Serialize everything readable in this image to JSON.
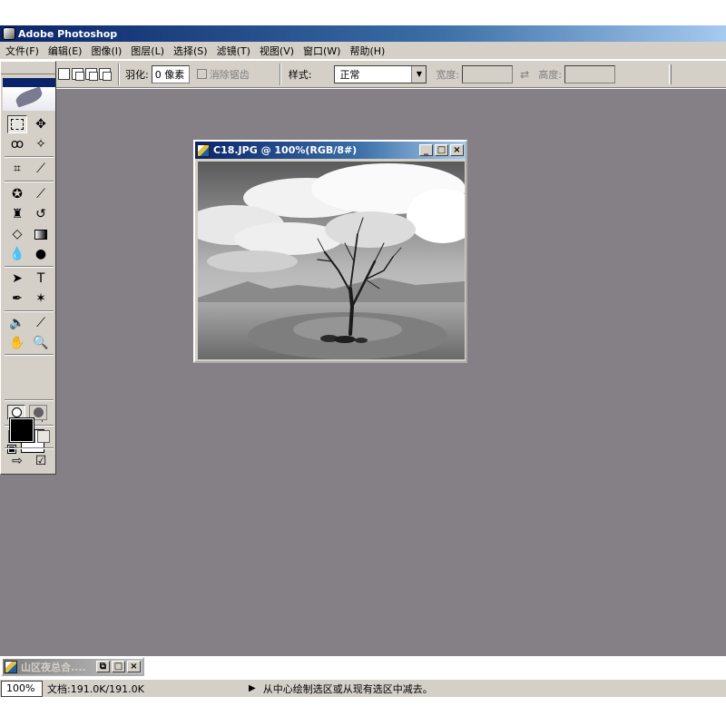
{
  "app": {
    "title": "Adobe Photoshop"
  },
  "menu": [
    "文件(F)",
    "编辑(E)",
    "图像(I)",
    "图层(L)",
    "选择(S)",
    "滤镜(T)",
    "视图(V)",
    "窗口(W)",
    "帮助(H)"
  ],
  "options": {
    "feather_label": "羽化:",
    "feather_value": "0 像素",
    "antialias_label": "消除锯齿",
    "style_label": "样式:",
    "style_value": "正常",
    "width_label": "宽度:",
    "height_label": "高度:"
  },
  "document": {
    "title": "C18.JPG @ 100%(RGB/8#)",
    "window_buttons": [
      "_",
      "□",
      "×"
    ]
  },
  "minimized_document": {
    "title": "山区夜总合...."
  },
  "status": {
    "zoom": "100%",
    "doc_size": "文档:191.0K/191.0K",
    "hint": "从中心绘制选区或从现有选区中减去。"
  },
  "toolbox": {
    "tools": [
      "rectangular-marquee",
      "move",
      "lasso",
      "magic-wand",
      "crop",
      "slice",
      "healing-brush",
      "brush",
      "clone-stamp",
      "history-brush",
      "eraser",
      "gradient",
      "blur",
      "dodge",
      "path-selection",
      "type",
      "pen",
      "custom-shape",
      "notes",
      "eyedropper",
      "hand",
      "zoom"
    ],
    "foreground_color": "#000000",
    "background_color": "#ffffff"
  },
  "colors": {
    "titlebar_start": "#0a246a",
    "titlebar_end": "#a6caf0",
    "workspace": "#858085",
    "chrome": "#d4d0c8"
  }
}
